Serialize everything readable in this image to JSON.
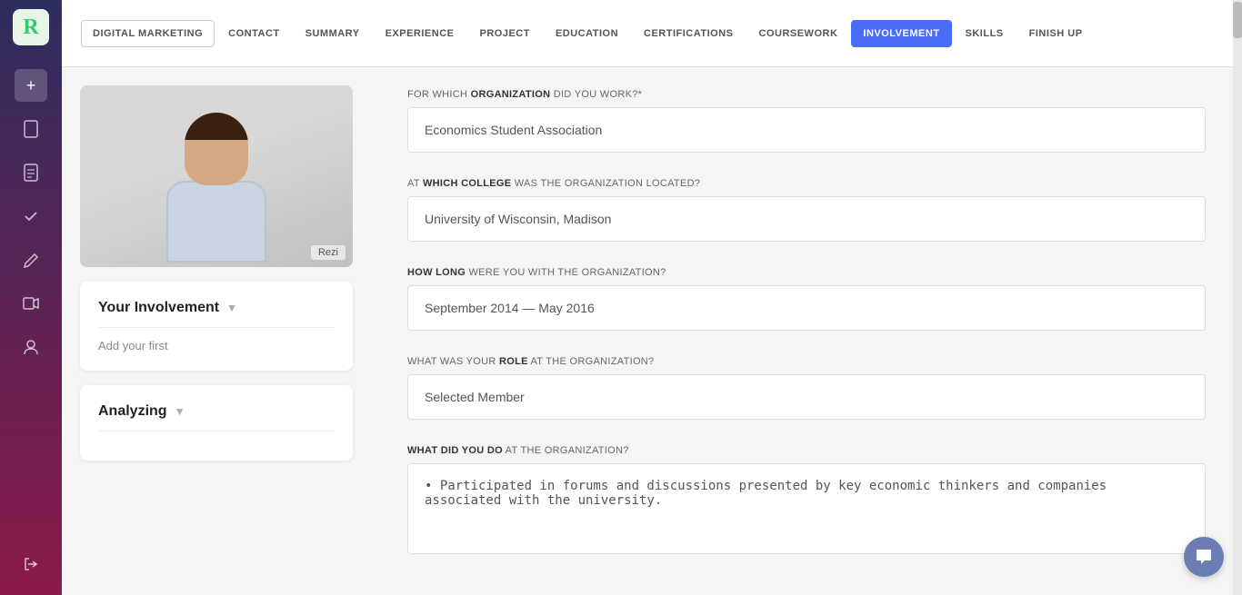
{
  "logo": {
    "letter": "R"
  },
  "sidebar": {
    "icons": [
      {
        "name": "add-icon",
        "symbol": "+",
        "active": true
      },
      {
        "name": "document1-icon",
        "symbol": "🗋",
        "active": false
      },
      {
        "name": "document2-icon",
        "symbol": "🗋",
        "active": false
      },
      {
        "name": "checklist-icon",
        "symbol": "✓",
        "active": false
      },
      {
        "name": "edit-icon",
        "symbol": "✎",
        "active": false
      },
      {
        "name": "video-icon",
        "symbol": "▶",
        "active": false
      },
      {
        "name": "person-icon",
        "symbol": "👤",
        "active": false
      }
    ],
    "bottom_icon": {
      "name": "logout-icon",
      "symbol": "→"
    }
  },
  "nav": {
    "items": [
      {
        "label": "DIGITAL MARKETING",
        "active": false,
        "bordered": true
      },
      {
        "label": "CONTACT",
        "active": false,
        "bordered": false
      },
      {
        "label": "SUMMARY",
        "active": false,
        "bordered": false
      },
      {
        "label": "EXPERIENCE",
        "active": false,
        "bordered": false
      },
      {
        "label": "PROJECT",
        "active": false,
        "bordered": false
      },
      {
        "label": "EDUCATION",
        "active": false,
        "bordered": false
      },
      {
        "label": "CERTIFICATIONS",
        "active": false,
        "bordered": false
      },
      {
        "label": "COURSEWORK",
        "active": false,
        "bordered": false
      },
      {
        "label": "INVOLVEMENT",
        "active": true,
        "bordered": false
      },
      {
        "label": "SKILLS",
        "active": false,
        "bordered": false
      },
      {
        "label": "FINISH UP",
        "active": false,
        "bordered": false
      }
    ]
  },
  "left_panel": {
    "photo_badge": "Rezi",
    "involvement_card": {
      "title": "Your Involvement",
      "subtitle": "Add your first"
    },
    "analyzing_card": {
      "title": "Analyzing"
    }
  },
  "right_panel": {
    "fields": [
      {
        "label_prefix": "FOR WHICH ",
        "label_bold": "ORGANIZATION",
        "label_suffix": " DID YOU WORK?*",
        "value": "Economics Student Association",
        "type": "input",
        "name": "organization-input"
      },
      {
        "label_prefix": "AT ",
        "label_bold": "WHICH COLLEGE",
        "label_suffix": " WAS THE ORGANIZATION LOCATED?",
        "value": "University of Wisconsin, Madison",
        "type": "input",
        "name": "college-input"
      },
      {
        "label_prefix": "HOW LONG",
        "label_bold": "",
        "label_suffix": " WERE YOU WITH THE ORGANIZATION?",
        "value": "September 2014 — May 2016",
        "type": "input",
        "name": "duration-input"
      },
      {
        "label_prefix": "WHAT WAS YOUR ",
        "label_bold": "ROLE",
        "label_suffix": " AT THE ORGANIZATION?",
        "value": "Selected Member",
        "type": "input",
        "name": "role-input"
      },
      {
        "label_prefix": "WHAT DID YOU DO",
        "label_bold": "",
        "label_suffix": " AT THE ORGANIZATION?",
        "value": "• Participated in forums and discussions presented by key economic thinkers and companies associated with the university.",
        "type": "textarea",
        "name": "description-textarea"
      }
    ]
  }
}
